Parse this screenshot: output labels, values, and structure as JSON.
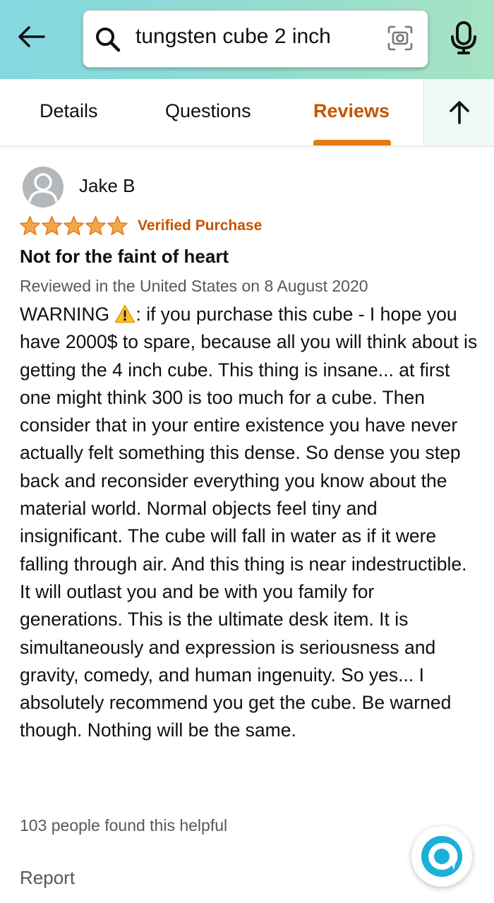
{
  "search": {
    "query": "tungsten cube 2 inch",
    "icons": [
      "back-arrow-icon",
      "search-icon",
      "camera-scan-icon",
      "microphone-icon"
    ]
  },
  "tabs": [
    {
      "label": "Details",
      "active": false
    },
    {
      "label": "Questions",
      "active": false
    },
    {
      "label": "Reviews",
      "active": true
    }
  ],
  "colors": {
    "header_gradient_start": "#84d8e0",
    "header_gradient_end": "#a7e3c3",
    "active_tab": "#c45500",
    "tab_indicator": "#e47911",
    "star": "#f3a847",
    "verified": "#c45500",
    "muted_text": "#565959",
    "alexa": "#1ab0d8"
  },
  "review": {
    "reviewer": "Jake B",
    "rating": 5,
    "verified_label": "Verified Purchase",
    "title": "Not for the faint of heart",
    "meta": "Reviewed in the United States on 8 August 2020",
    "body_warning": "WARNING",
    "body": ": if you purchase this cube - I hope you have 2000$ to spare, because all you will think about is getting the 4 inch cube. This thing is insane... at first one might think 300 is too much for a cube. Then consider that in your entire existence you have never actually felt something this dense. So dense you step back and reconsider everything you know about the material world. Normal objects feel tiny and insignificant. The cube will fall in water as if it were falling through air. And this thing is near indestructible. It will outlast you and be with you family for generations. This is the ultimate desk item. It is simultaneously and expression is seriousness and gravity, comedy, and human ingenuity. So yes... I absolutely recommend you get the cube. Be warned though. Nothing will be the same.",
    "helpful": "103 people found this helpful",
    "report_label": "Report"
  }
}
